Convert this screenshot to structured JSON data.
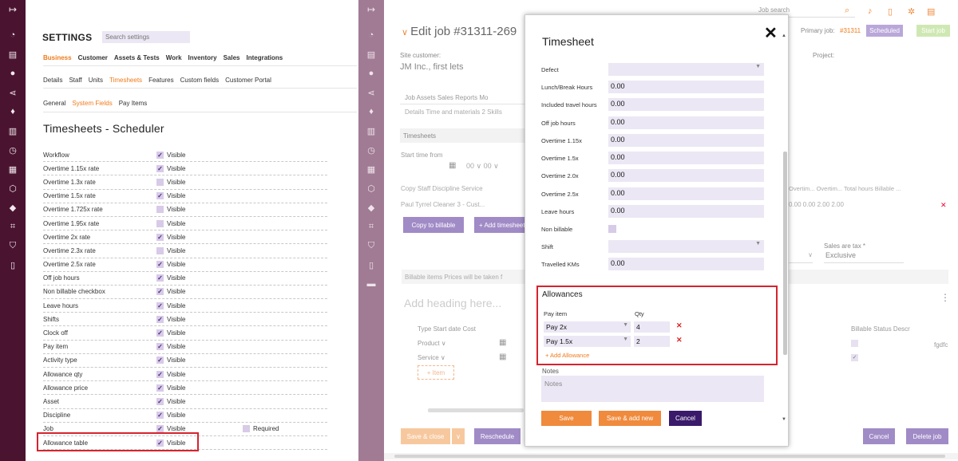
{
  "left": {
    "settings_title": "SETTINGS",
    "search_placeholder": "Search settings",
    "tabs1": [
      "Business",
      "Customer",
      "Assets & Tests",
      "Work",
      "Inventory",
      "Sales",
      "Integrations"
    ],
    "tabs2": [
      "Details",
      "Staff",
      "Units",
      "Timesheets",
      "Features",
      "Custom fields",
      "Customer Portal"
    ],
    "tabs3": [
      "General",
      "System Fields",
      "Pay Items"
    ],
    "page_title": "Timesheets - Scheduler",
    "visible_label": "Visible",
    "required_label": "Required",
    "fields": [
      {
        "label": "Workflow",
        "checked": true
      },
      {
        "label": "Overtime 1.15x rate",
        "checked": true
      },
      {
        "label": "Overtime 1.3x rate",
        "checked": false
      },
      {
        "label": "Overtime 1.5x rate",
        "checked": true
      },
      {
        "label": "Overtime 1.725x rate",
        "checked": false
      },
      {
        "label": "Overtime 1.95x rate",
        "checked": false
      },
      {
        "label": "Overtime 2x rate",
        "checked": true
      },
      {
        "label": "Overtime 2.3x rate",
        "checked": false
      },
      {
        "label": "Overtime 2.5x rate",
        "checked": true
      },
      {
        "label": "Off job hours",
        "checked": true
      },
      {
        "label": "Non billable checkbox",
        "checked": true
      },
      {
        "label": "Leave hours",
        "checked": true
      },
      {
        "label": "Shifts",
        "checked": true
      },
      {
        "label": "Clock off",
        "checked": true
      },
      {
        "label": "Pay item",
        "checked": true
      },
      {
        "label": "Activity type",
        "checked": true
      },
      {
        "label": "Allowance qty",
        "checked": true
      },
      {
        "label": "Allowance price",
        "checked": true
      },
      {
        "label": "Asset",
        "checked": true
      },
      {
        "label": "Discipline",
        "checked": true
      },
      {
        "label": "Job",
        "checked": true,
        "required": true
      },
      {
        "label": "Allowance table",
        "checked": true
      }
    ]
  },
  "right": {
    "job_search_placeholder": "Job search",
    "edit_title": "Edit job #31311-269",
    "primary_job_label": "Primary job:",
    "primary_job_num": "#31311",
    "scheduled": "Scheduled",
    "start_job": "Start job",
    "site_customer_label": "Site customer:",
    "site_customer_value": "JM Inc., first lets",
    "project_label": "Project:",
    "job_tabs": "Job   Assets   Sales   Reports   Mo",
    "job_tabs2": "Details   Time and materials 2   Skills",
    "timesheets_section": "Timesheets",
    "start_time_label": "Start time from",
    "start_time_row": "00  ∨  00  ∨",
    "ts_head": "Copy   Staff          Discipline   Service",
    "ts_row": "        Paul Tyrrel  Cleaner     3 - Cust...",
    "right_cols": "Overtim...  Overtim...  Total hours  Billable ...",
    "right_vals": "0.00          0.00          2.00           2.00",
    "copy_to_billable": "Copy to billable",
    "add_timesheet": "+ Add timesheet",
    "sales_tax_label": "Sales are tax *",
    "sales_tax_value": "Exclusive",
    "billable_items": "Billable items     Prices will be taken f",
    "add_heading": "Add heading here...",
    "bi_head": "Type                     Start date      Cost",
    "bi_r1": "Product              ∨",
    "bi_r2": "Service               ∨",
    "bi_add": "+ Item",
    "right_billable": "Billable     Status             Descr",
    "right_fgdf": "fgdfc",
    "save_close": "Save & close",
    "reschedule": "Reschedule",
    "cancel": "Cancel",
    "delete_job": "Delete job"
  },
  "modal": {
    "title": "Timesheet",
    "rows": [
      {
        "label": "Defect",
        "value": "",
        "dropdown": true
      },
      {
        "label": "Lunch/Break Hours",
        "value": "0.00"
      },
      {
        "label": "Included travel hours",
        "value": "0.00"
      },
      {
        "label": "Off job hours",
        "value": "0.00"
      },
      {
        "label": "Overtime 1.15x",
        "value": "0.00"
      },
      {
        "label": "Overtime 1.5x",
        "value": "0.00"
      },
      {
        "label": "Overtime 2.0x",
        "value": "0.00"
      },
      {
        "label": "Overtime 2.5x",
        "value": "0.00"
      },
      {
        "label": "Leave hours",
        "value": "0.00"
      },
      {
        "label": "Non billable",
        "checkbox": true
      },
      {
        "label": "Shift",
        "value": "",
        "dropdown": true
      },
      {
        "label": "Travelled KMs",
        "value": "0.00"
      }
    ],
    "allowances_title": "Allowances",
    "pay_item_header": "Pay item",
    "qty_header": "Qty",
    "allowances": [
      {
        "pay_item": "Pay 2x",
        "qty": "4"
      },
      {
        "pay_item": "Pay 1.5x",
        "qty": "2"
      }
    ],
    "add_allowance": "+ Add Allowance",
    "notes_label": "Notes",
    "notes_placeholder": "Notes",
    "save": "Save",
    "save_add_new": "Save & add new",
    "cancel": "Cancel"
  },
  "colors": {
    "accent": "#f07a1a",
    "sidebar": "#4a1430",
    "purple": "#a08bc6",
    "highlight": "#d6232e"
  }
}
